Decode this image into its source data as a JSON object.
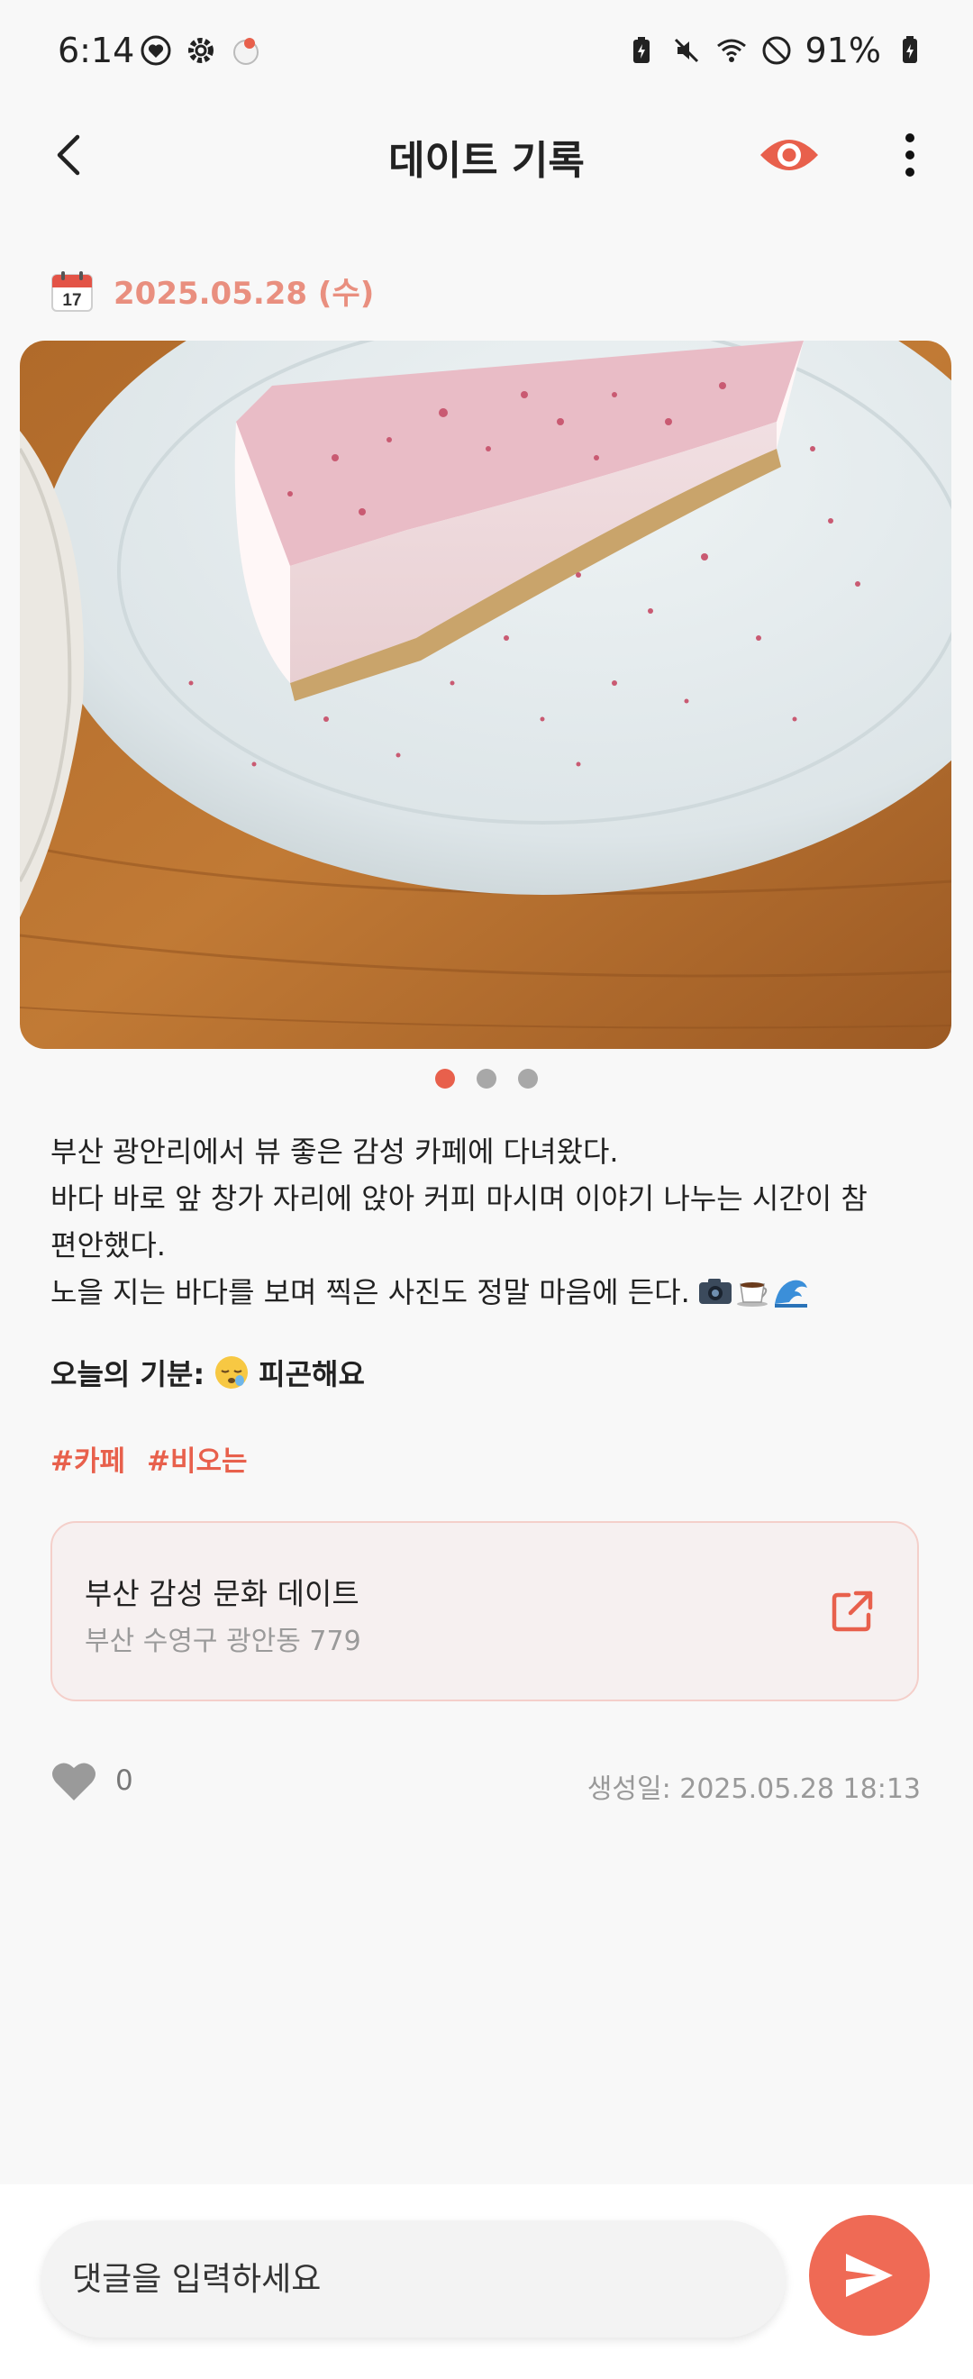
{
  "status_bar": {
    "time": "6:14",
    "battery": "91%"
  },
  "app_bar": {
    "title": "데이트 기록"
  },
  "record": {
    "date": "2025.05.28 (수)",
    "calendar_day": "17",
    "photo_count": 3,
    "active_photo_index": 0,
    "text_lines": [
      "부산 광안리에서 뷰 좋은 감성 카페에 다녀왔다.",
      "바다 바로 앞 창가 자리에 앉아 커피 마시며 이야기 나누는 시간이 참",
      "편안했다.",
      "노을 지는 바다를 보며 찍은 사진도 정말 마음에 든다."
    ],
    "trailing_emojis": [
      "camera-icon",
      "coffee-icon",
      "wave-icon"
    ],
    "mood_label": "오늘의 기분:",
    "mood_text": "피곤해요",
    "tags": [
      "#카페",
      "#비오는"
    ]
  },
  "course": {
    "title": "부산 감성 문화 데이트",
    "address": "부산 수영구 광안동 779"
  },
  "footer": {
    "like_count": "0",
    "created_at": "생성일: 2025.05.28 18:13"
  },
  "comment": {
    "placeholder": "댓글을 입력하세요"
  },
  "colors": {
    "accent": "#e8604c",
    "date": "#e98f7f",
    "send_button": "#ef6a55"
  }
}
